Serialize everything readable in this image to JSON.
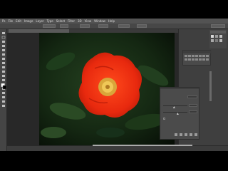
{
  "menu": [
    "Ps",
    "File",
    "Edit",
    "Image",
    "Layer",
    "Type",
    "Select",
    "Filter",
    "3D",
    "View",
    "Window",
    "Help"
  ],
  "document_tab": "",
  "panels": {
    "adjustments": {
      "title": "",
      "sliders": [
        0.45,
        0.6
      ]
    }
  },
  "colors": {
    "app_bg": "#3a3a3a",
    "flower_red": "#e8290e",
    "flower_center": "#e0b040",
    "foliage": "#1f3a1f",
    "foreground_swatch": "#ffffff",
    "background_swatch": "#000000"
  },
  "icons": [
    "move-icon",
    "marquee-icon",
    "lasso-icon",
    "quick-select-icon",
    "crop-icon",
    "eyedropper-icon",
    "healing-icon",
    "brush-icon",
    "stamp-icon",
    "history-brush-icon",
    "eraser-icon",
    "gradient-icon",
    "blur-icon",
    "dodge-icon",
    "pen-icon",
    "type-icon",
    "path-select-icon",
    "shape-icon",
    "hand-icon",
    "zoom-icon"
  ]
}
